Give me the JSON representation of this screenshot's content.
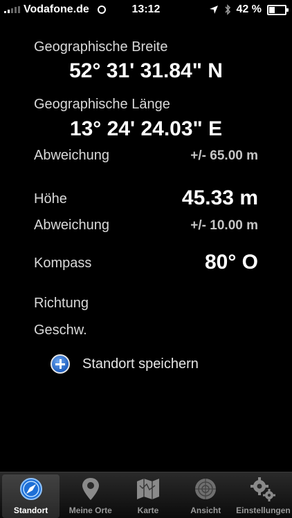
{
  "status_bar": {
    "carrier": "Vodafone.de",
    "time": "13:12",
    "battery": "42 %",
    "battery_level": 0.42
  },
  "location": {
    "latitude_label": "Geographische Breite",
    "latitude_value": "52° 31' 31.84\" N",
    "longitude_label": "Geographische Länge",
    "longitude_value": "13° 24' 24.03\" E",
    "accuracy_label": "Abweichung",
    "accuracy_value": "+/- 65.00 m"
  },
  "altitude": {
    "label": "Höhe",
    "value": "45.33 m",
    "accuracy_label": "Abweichung",
    "accuracy_value": "+/- 10.00 m"
  },
  "compass": {
    "label": "Kompass",
    "value": "80° O"
  },
  "heading": {
    "label": "Richtung"
  },
  "speed": {
    "label": "Geschw."
  },
  "save_location": {
    "label": "Standort speichern"
  },
  "tabs": [
    {
      "label": "Standort",
      "icon": "compass-icon",
      "active": true
    },
    {
      "label": "Meine Orte",
      "icon": "pin-icon",
      "active": false
    },
    {
      "label": "Karte",
      "icon": "map-icon",
      "active": false
    },
    {
      "label": "Ansicht",
      "icon": "radar-icon",
      "active": false
    },
    {
      "label": "Einstellungen",
      "icon": "gears-icon",
      "active": false
    }
  ]
}
